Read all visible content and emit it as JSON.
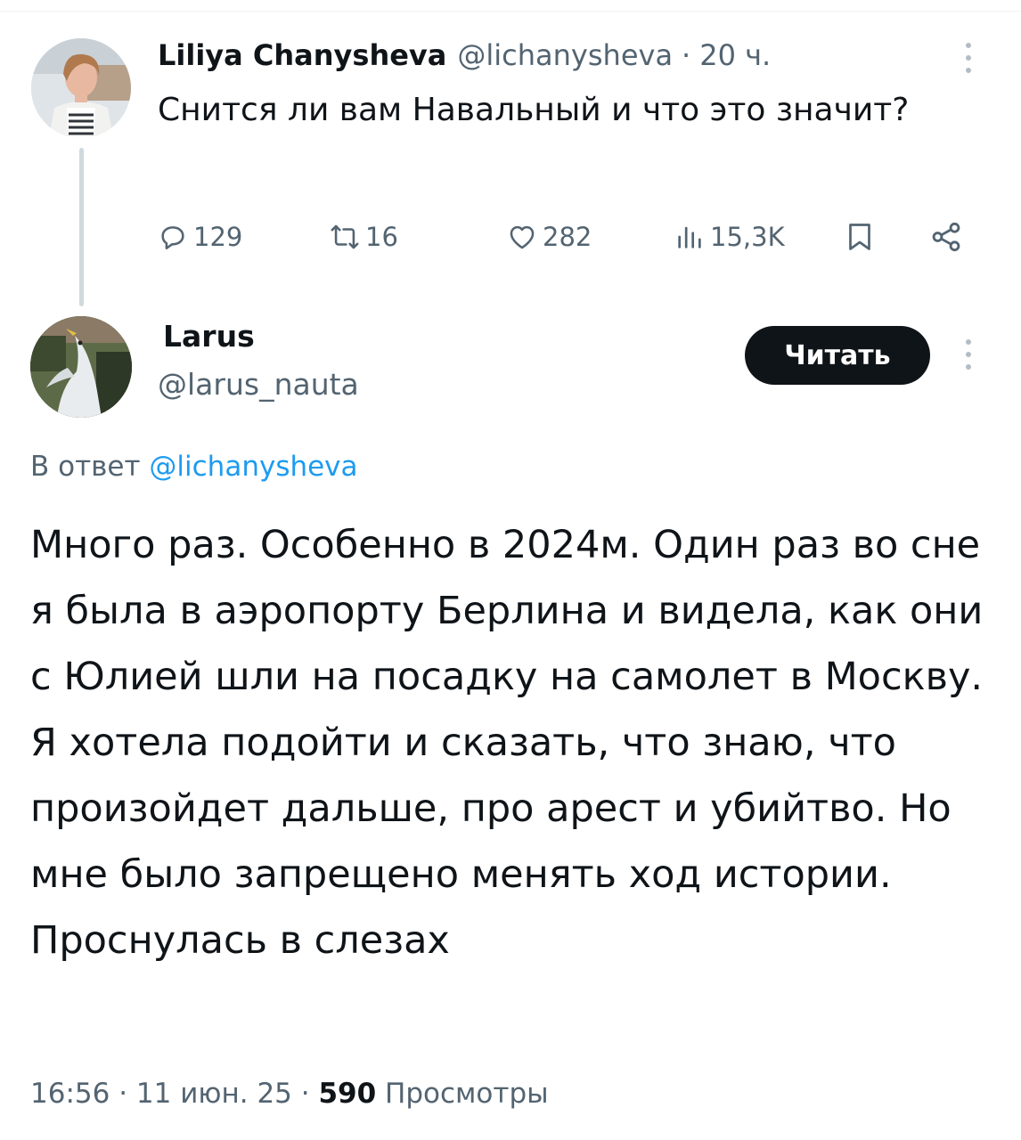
{
  "parent_tweet": {
    "author_name": "Liliya Chanysheva",
    "author_handle": "@lichanysheva",
    "separator": "·",
    "time": "20 ч.",
    "text": "Снится ли вам Навальный и что это значит?",
    "actions": {
      "replies": "129",
      "reposts": "16",
      "likes": "282",
      "views": "15,3K"
    }
  },
  "reply_tweet": {
    "author_name": "Larus",
    "author_handle": "@larus_nauta",
    "follow_label": "Читать",
    "reply_prefix": "В ответ",
    "reply_mention": "@lichanysheva",
    "text": "Много раз. Особенно в 2024м. Один раз во сне я была в аэропорту Берлина и видела, как они с Юлией шли на посадку на самолет в Москву. Я хотела подойти и сказать, что знаю, что произойдет дальше, про арест и убийтво. Но мне было запрещено менять ход истории. Проснулась в слезах",
    "time": "16:56",
    "separator": "·",
    "date": "11 июн. 25",
    "views_count": "590",
    "views_label": "Просмотры"
  },
  "colors": {
    "text_primary": "#0f1419",
    "text_secondary": "#536471",
    "link": "#1d9bf0",
    "follow_button_bg": "#0f1419",
    "thread_line": "#cfd9de"
  },
  "icons": {
    "reply": "speech-bubble-icon",
    "repost": "repost-arrows-icon",
    "like": "heart-icon",
    "views": "bar-chart-icon",
    "bookmark": "bookmark-icon",
    "share": "share-nodes-icon",
    "more": "vertical-ellipsis-icon"
  }
}
